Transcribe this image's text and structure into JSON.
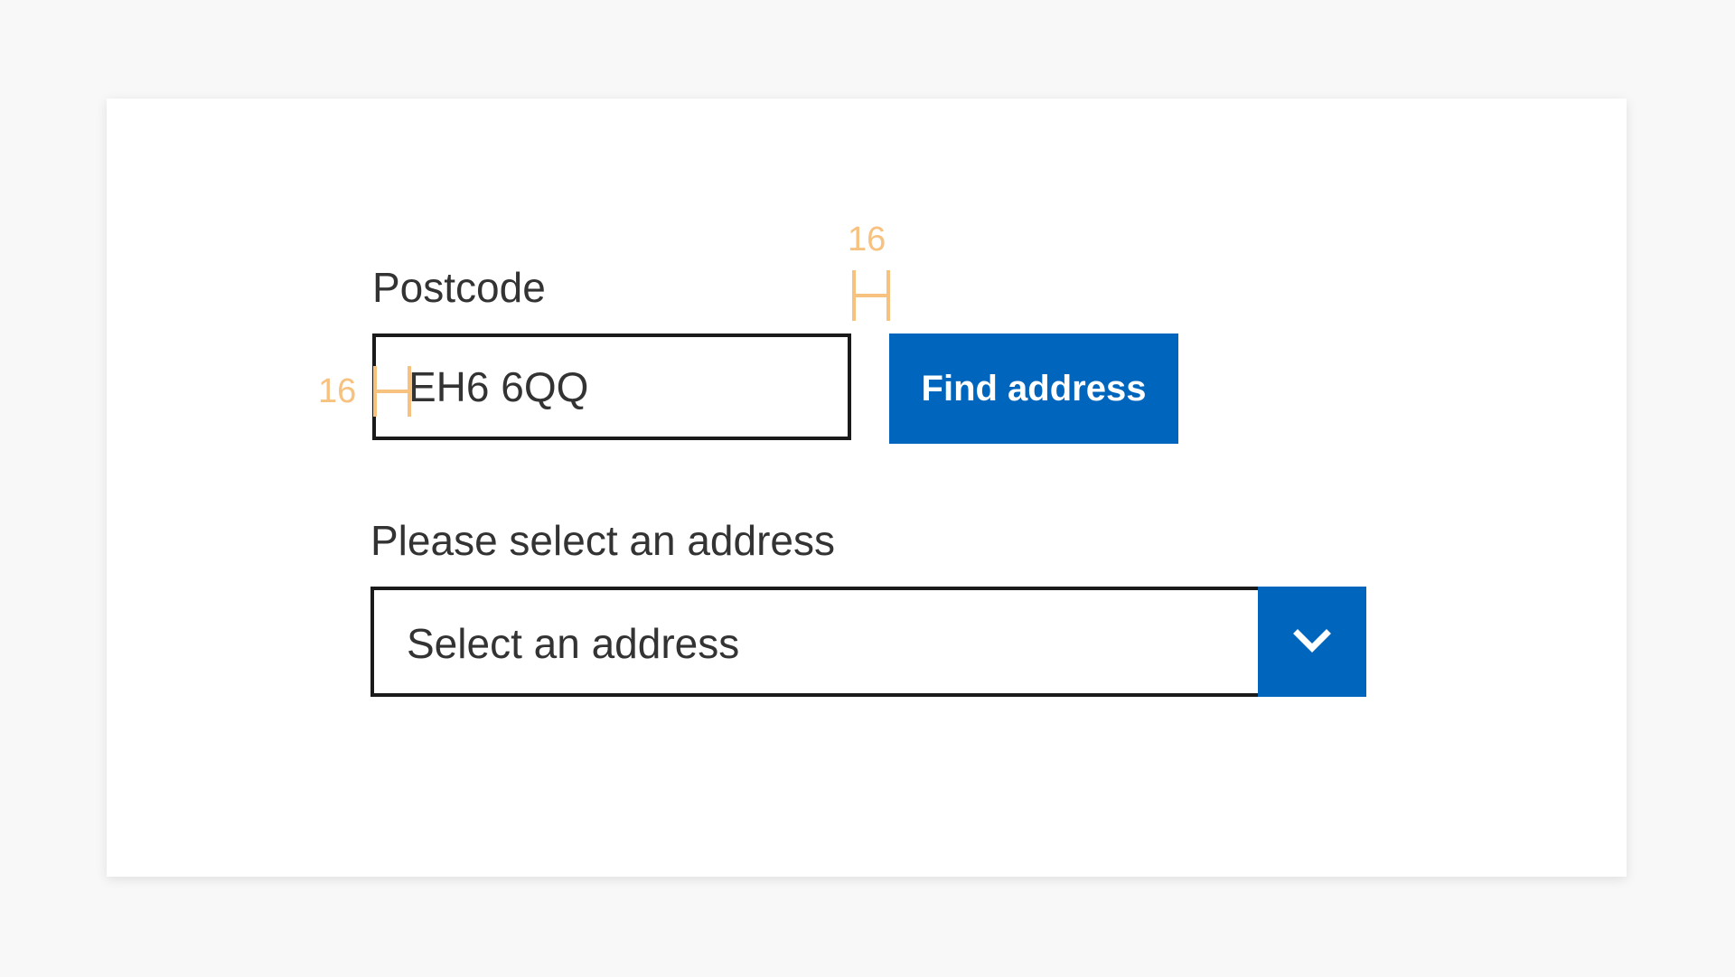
{
  "form": {
    "postcode_label": "Postcode",
    "postcode_value": "EH6 6QQ",
    "find_button_label": "Find address",
    "address_label": "Please select an address",
    "address_select_value": "Select an address"
  },
  "spacing_annotations": {
    "gap_label": "16",
    "padding_label": "16"
  },
  "colors": {
    "primary": "#0065bd",
    "text": "#333333",
    "border": "#1a1a1a",
    "annotation": "#f7c17f",
    "background": "#f8f8f8",
    "card": "#ffffff"
  },
  "icons": {
    "select_arrow": "chevron-down-icon"
  }
}
